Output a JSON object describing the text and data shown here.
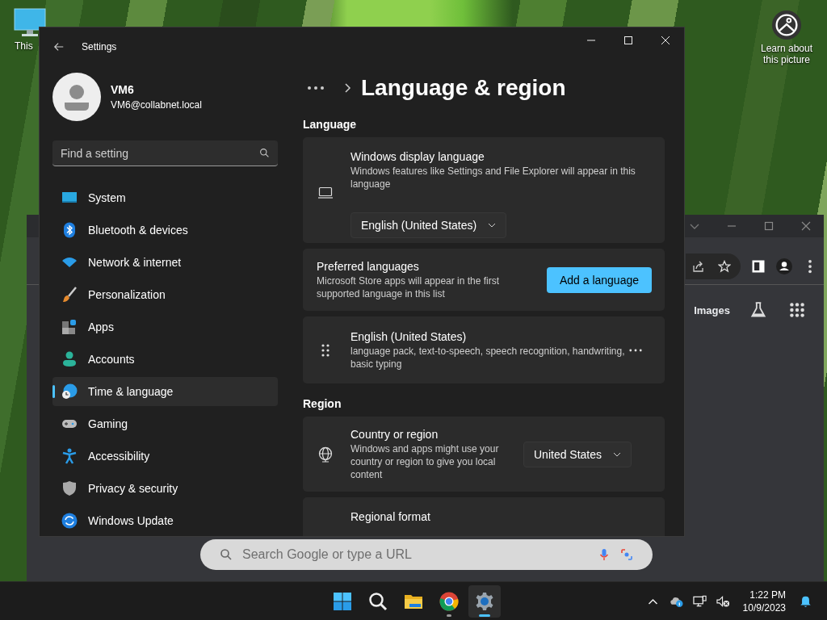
{
  "desktop": {
    "icons": [
      {
        "label": "This"
      }
    ],
    "spotlight": {
      "label": "Learn about this picture"
    }
  },
  "browser": {
    "links": [
      "Images"
    ],
    "search": {
      "placeholder": "Search Google or type a URL"
    }
  },
  "settings": {
    "title": "Settings",
    "user": {
      "name": "VM6",
      "email": "VM6@collabnet.local"
    },
    "search": {
      "placeholder": "Find a setting"
    },
    "nav": [
      {
        "label": "System",
        "selected": false
      },
      {
        "label": "Bluetooth & devices",
        "selected": false
      },
      {
        "label": "Network & internet",
        "selected": false
      },
      {
        "label": "Personalization",
        "selected": false
      },
      {
        "label": "Apps",
        "selected": false
      },
      {
        "label": "Accounts",
        "selected": false
      },
      {
        "label": "Time & language",
        "selected": true
      },
      {
        "label": "Gaming",
        "selected": false
      },
      {
        "label": "Accessibility",
        "selected": false
      },
      {
        "label": "Privacy & security",
        "selected": false
      },
      {
        "label": "Windows Update",
        "selected": false
      }
    ],
    "page_title": "Language & region",
    "sections": [
      {
        "heading": "Language",
        "cards": [
          {
            "kind": "display",
            "title": "Windows display language",
            "description": "Windows features like Settings and File Explorer will appear in this language",
            "value": "English (United States)"
          },
          {
            "kind": "action",
            "title": "Preferred languages",
            "description": "Microsoft Store apps will appear in the first supported language in this list",
            "button": "Add a language"
          },
          {
            "kind": "language",
            "title": "English (United States)",
            "description": "language pack, text-to-speech, speech recognition, handwriting, basic typing"
          }
        ]
      },
      {
        "heading": "Region",
        "cards": [
          {
            "kind": "region",
            "title": "Country or region",
            "description": "Windows and apps might use your country or region to give you local content",
            "value": "United States"
          },
          {
            "kind": "plain",
            "title": "Regional format"
          }
        ]
      }
    ]
  },
  "taskbar": {
    "apps": [
      {
        "running": false,
        "selected": false
      },
      {
        "running": false,
        "selected": false
      },
      {
        "running": false,
        "selected": false
      },
      {
        "running": true,
        "selected": false
      },
      {
        "running": true,
        "selected": true
      }
    ],
    "clock": {
      "time": "1:22 PM",
      "date": "10/9/2023"
    }
  }
}
